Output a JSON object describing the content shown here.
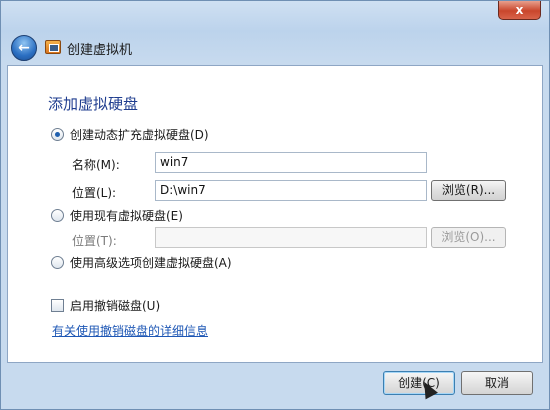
{
  "window": {
    "title": "创建虚拟机",
    "close_glyph": "x",
    "back_glyph": "←"
  },
  "content": {
    "heading": "添加虚拟硬盘",
    "options": [
      {
        "label": "创建动态扩充虚拟硬盘(D)",
        "checked": true,
        "name_label": "名称(M):",
        "name_value": "win7",
        "location_label": "位置(L):",
        "location_value": "D:\\win7",
        "browse_label": "浏览(R)..."
      },
      {
        "label": "使用现有虚拟硬盘(E)",
        "checked": false,
        "location_label": "位置(T):",
        "location_value": "",
        "browse_label": "浏览(O)..."
      },
      {
        "label": "使用高级选项创建虚拟硬盘(A)",
        "checked": false
      }
    ],
    "undo_disk_checkbox": {
      "label": "启用撤销磁盘(U)",
      "checked": false
    },
    "details_link": "有关使用撤销磁盘的详细信息"
  },
  "footer": {
    "create_label": "创建(C)",
    "cancel_label": "取消"
  }
}
